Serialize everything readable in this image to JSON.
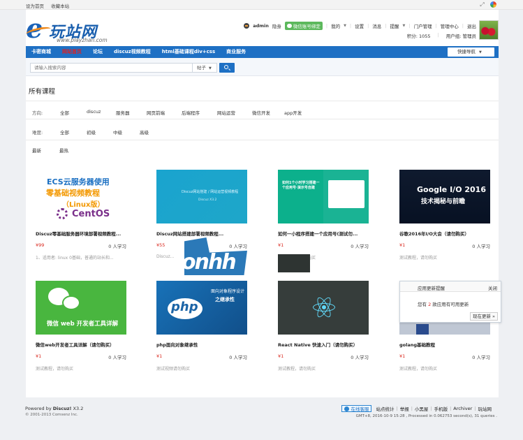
{
  "topbar": {
    "links": [
      "设为首页",
      "收藏本站"
    ],
    "icons": [
      "expand-icon",
      "app-color-icon"
    ]
  },
  "header": {
    "logo": {
      "title": "玩站网",
      "url": "www.playzhan.com"
    },
    "user": {
      "name": "admin",
      "status": "隐身",
      "wechat_label": "微信账号绑定",
      "menu": [
        "我的",
        "设置",
        "消息",
        "提醒",
        "门户管理",
        "管理中心",
        "退出"
      ],
      "points": "积分: 1055",
      "group": "用户组: 管理员"
    }
  },
  "nav": {
    "items": [
      {
        "label": "卡密商城",
        "active": false
      },
      {
        "label": "网站首页",
        "active": true
      },
      {
        "label": "论坛",
        "active": false
      },
      {
        "label": "discuz视频教程",
        "active": false
      },
      {
        "label": "html基础课程div+css",
        "active": false
      },
      {
        "label": "商业服务",
        "active": false
      }
    ],
    "quick_nav": "快捷导航"
  },
  "search": {
    "placeholder": "请输入搜索内容",
    "type": "帖子"
  },
  "page": {
    "title": "所有课程",
    "filters": [
      {
        "label": "方向:",
        "options": [
          "全部",
          "discuz",
          "服务器",
          "网页前端",
          "后端程序",
          "网站运营",
          "微信开发",
          "app开发"
        ]
      },
      {
        "label": "难度:",
        "options": [
          "全部",
          "初级",
          "中级",
          "高级"
        ]
      }
    ],
    "sort": [
      "最新",
      "最热"
    ]
  },
  "courses": [
    {
      "title": "Discuz零基础服务器环境部署视频教程...",
      "price": "¥99",
      "learners": "0 人学习",
      "desc": "1、适用者: linux 0基础，普通的站长和...",
      "thumb": {
        "l1": "ECS云服务器使用",
        "l2": "零基础视频教程",
        "l3": "（Linux版）",
        "l4": "CentOS"
      }
    },
    {
      "title": "Discuz网站搭建部署视频教程...",
      "price": "¥55",
      "learners": "0 人学习",
      "desc": "Discuz...",
      "thumb": {
        "l1": "Discuz网站搭建 / 网站运营视频教程",
        "l2": "Discuz X3.2"
      }
    },
    {
      "title": "如何一小程序搭建一个应用号(测试勿...",
      "price": "¥1",
      "learners": "0 人学习",
      "desc": "测试教程，请勿购买",
      "thumb": {
        "l1": "如何1个小时学习搭建一个应用号·演示号自建"
      }
    },
    {
      "title": "谷歌2016年I/O大会（请勿购买）",
      "price": "¥1",
      "learners": "0 人学习",
      "desc": "测试教程，请勿购买",
      "thumb": {
        "l1": "Google I/O 2016",
        "l2": "技术揭秘与前瞻"
      }
    },
    {
      "title": "微信web开发者工具详解（请勿购买）",
      "price": "¥1",
      "learners": "0 人学习",
      "desc": "测试教程，请勿购买",
      "thumb": {
        "l1": "微信 web 开发者工具详解"
      }
    },
    {
      "title": "php面向对象继承性",
      "price": "¥1",
      "learners": "0 人学习",
      "desc": "测试视频请勿购买",
      "thumb": {
        "l1": "php",
        "l2": "面向对象程序设计",
        "l3": "之继承性"
      }
    },
    {
      "title": "React Native 快速入门（请勿购买）",
      "price": "¥1",
      "learners": "0 人学习",
      "desc": "测试教程，请勿购买",
      "thumb": {}
    },
    {
      "title": "golang基础教程",
      "price": "¥1",
      "learners": "0 人学习",
      "desc": "测试教程，请勿购买",
      "thumb": {}
    }
  ],
  "popup": {
    "title": "应用更新提醒",
    "close": "关闭",
    "msg_prefix": "您有 ",
    "count": "2",
    "msg_suffix": " 款应用有可用更新",
    "button": "现在更新 »"
  },
  "overlay": {
    "text": "onhh"
  },
  "footer": {
    "powered_prefix": "Powered by ",
    "powered_brand": "Discuz!",
    "powered_version": " X3.2",
    "copyright": "© 2001-2013 Comsenz Inc.",
    "online": "在线客服",
    "links": [
      "站点统计",
      "举报",
      "小黑屋",
      "手机版",
      "Archiver",
      "玩站网"
    ],
    "gmt": "GMT+8, 2016-10-9 15:28 , Processed in 0.062753 second(s), 31 queries ."
  },
  "colors": {
    "nav": "#1e70c4",
    "price": "#d9261c",
    "active_nav": "#e02020"
  }
}
